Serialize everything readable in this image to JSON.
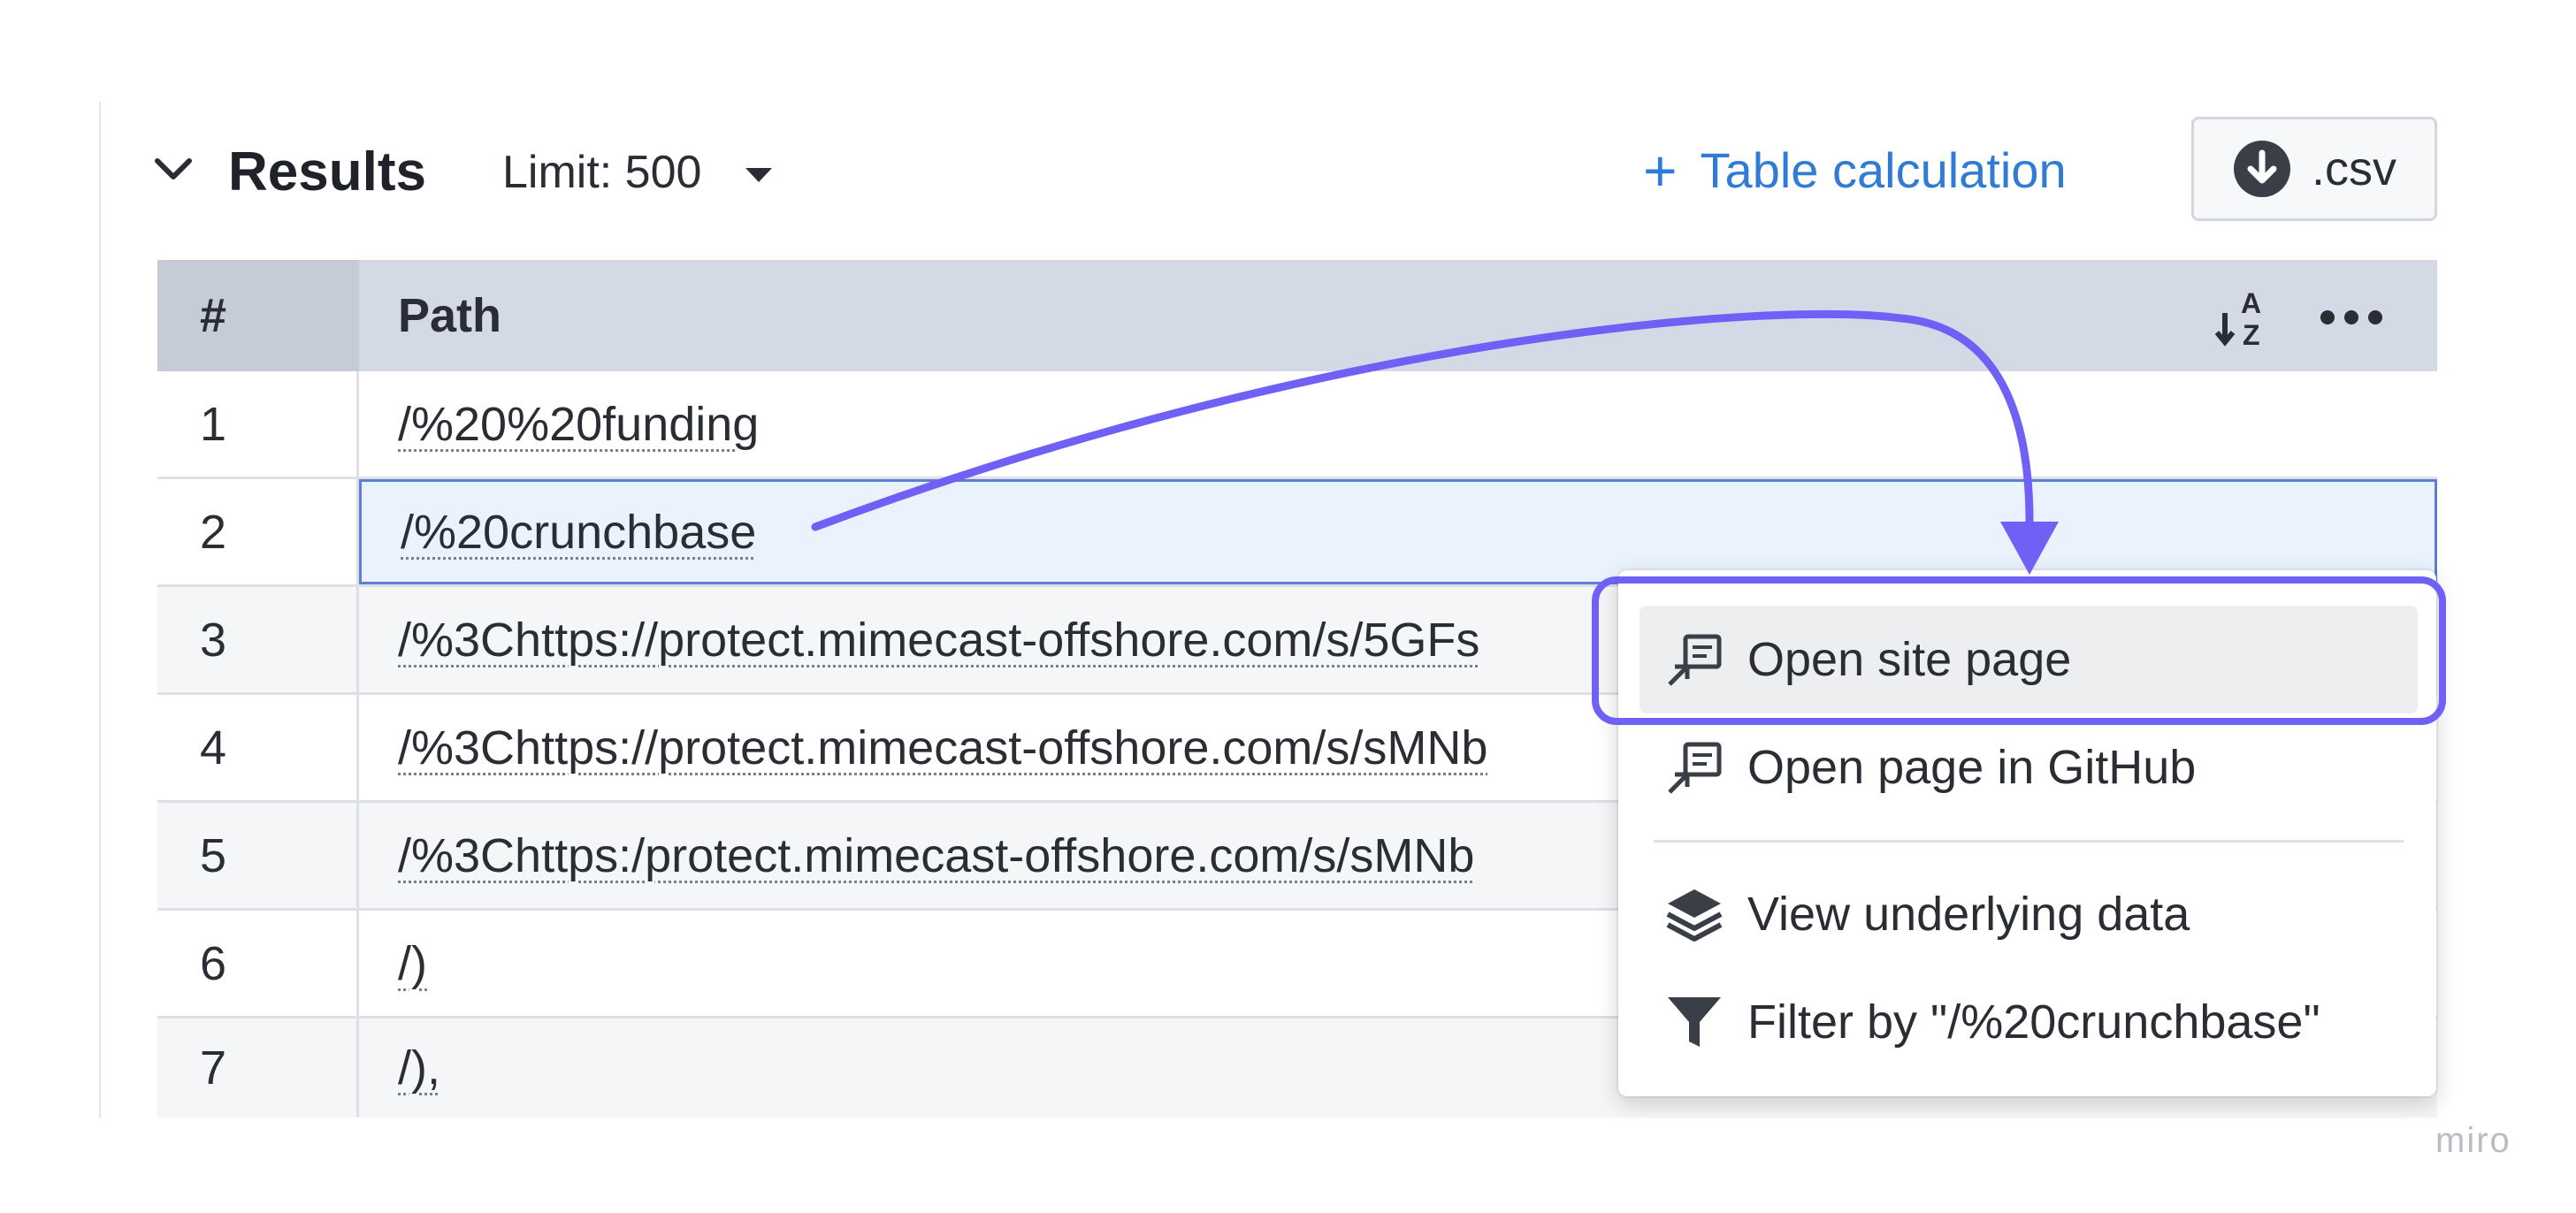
{
  "header": {
    "title": "Results",
    "limit_label": "Limit: 500",
    "table_calc_plus": "+",
    "table_calc_label": "Table calculation",
    "csv_label": ".csv"
  },
  "table": {
    "columns": [
      "#",
      "Path"
    ],
    "rows": [
      {
        "num": "1",
        "path": "/%20%20funding"
      },
      {
        "num": "2",
        "path": "/%20crunchbase"
      },
      {
        "num": "3",
        "path": "/%3Chttps://protect.mimecast-offshore.com/s/5GFs"
      },
      {
        "num": "4",
        "path": "/%3Chttps://protect.mimecast-offshore.com/s/sMNb"
      },
      {
        "num": "5",
        "path": "/%3Chttps:/protect.mimecast-offshore.com/s/sMNb"
      },
      {
        "num": "6",
        "path": "/)"
      },
      {
        "num": "7",
        "path": "/),"
      }
    ],
    "selected_row": 2
  },
  "context_menu": {
    "items": [
      {
        "label": "Open site page",
        "icon": "open-external-icon",
        "highlighted": true
      },
      {
        "label": "Open page in GitHub",
        "icon": "open-external-icon",
        "highlighted": false
      },
      {
        "label": "View underlying data",
        "icon": "layers-icon",
        "highlighted": false
      },
      {
        "label": "Filter by \"/%20crunchbase\"",
        "icon": "filter-icon",
        "highlighted": false
      }
    ]
  },
  "watermark": "miro",
  "colors": {
    "accent_blue": "#2f7bd6",
    "annotation_purple": "#7060f5",
    "header_bg": "#d3dae6",
    "selected_bg": "#eaf3fd"
  }
}
